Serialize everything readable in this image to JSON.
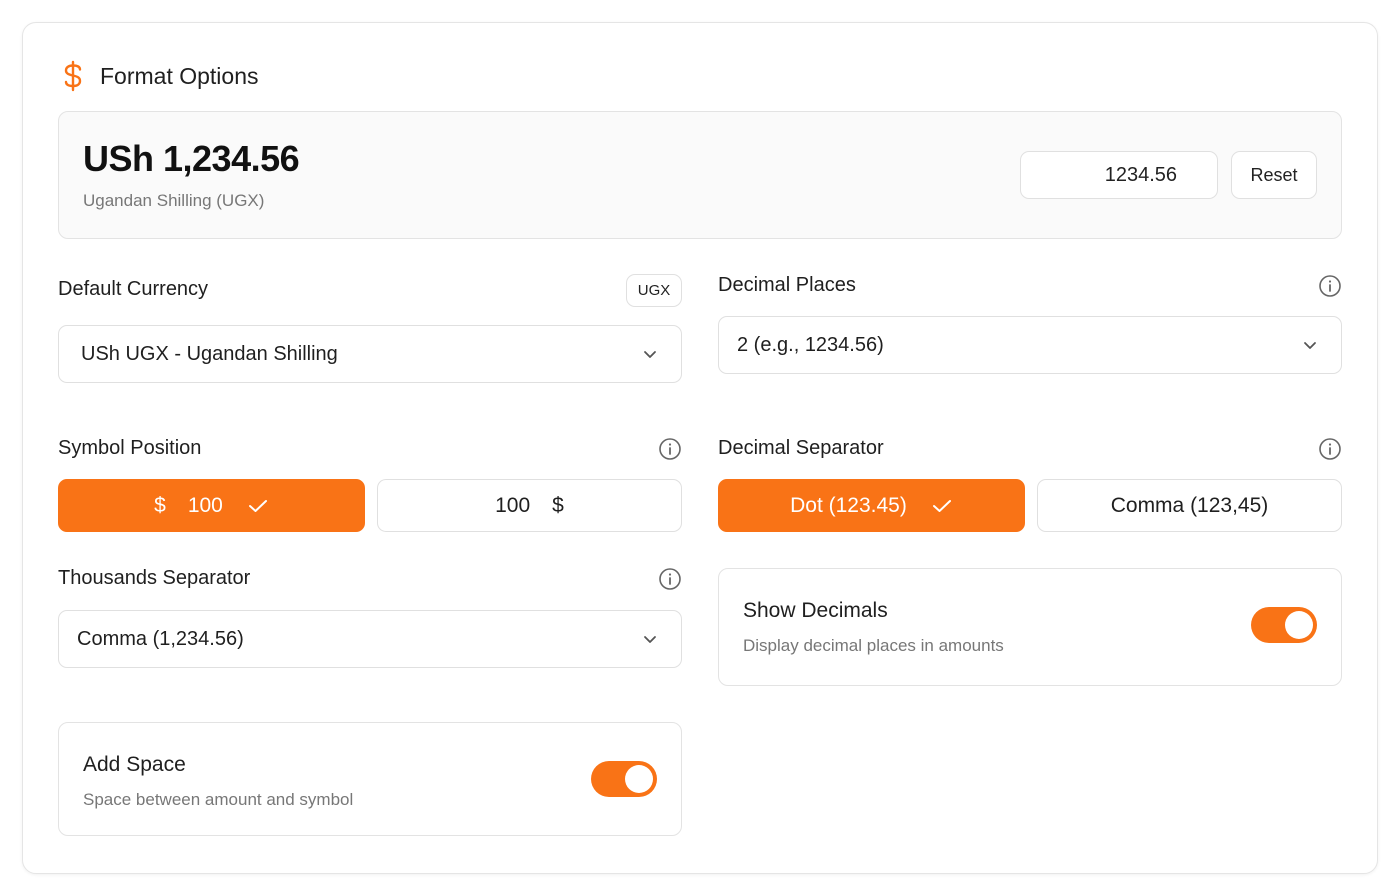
{
  "header": {
    "icon": "dollar-sign-icon",
    "title": "Format Options",
    "accent_color": "#f97316"
  },
  "preview": {
    "formatted_amount": "USh 1,234.56",
    "currency_name": "Ugandan Shilling (UGX)",
    "amount_input_value": "1234.56",
    "reset_label": "Reset"
  },
  "default_currency": {
    "label": "Default Currency",
    "badge": "UGX",
    "selected": "USh UGX - Ugandan Shilling"
  },
  "decimal_places": {
    "label": "Decimal Places",
    "selected": "2 (e.g., 1234.56)"
  },
  "symbol_position": {
    "label": "Symbol Position",
    "options": [
      {
        "symbol": "$",
        "number": "100",
        "selected": true
      },
      {
        "symbol": "$",
        "number": "100",
        "selected": false
      }
    ]
  },
  "decimal_separator": {
    "label": "Decimal Separator",
    "options": [
      {
        "label": "Dot (123.45)",
        "selected": true
      },
      {
        "label": "Comma (123,45)",
        "selected": false
      }
    ]
  },
  "thousands_separator": {
    "label": "Thousands Separator",
    "selected": "Comma (1,234.56)"
  },
  "show_decimals": {
    "title": "Show Decimals",
    "description": "Display decimal places in amounts",
    "enabled": true
  },
  "add_space": {
    "title": "Add Space",
    "description": "Space between amount and symbol",
    "enabled": true
  }
}
